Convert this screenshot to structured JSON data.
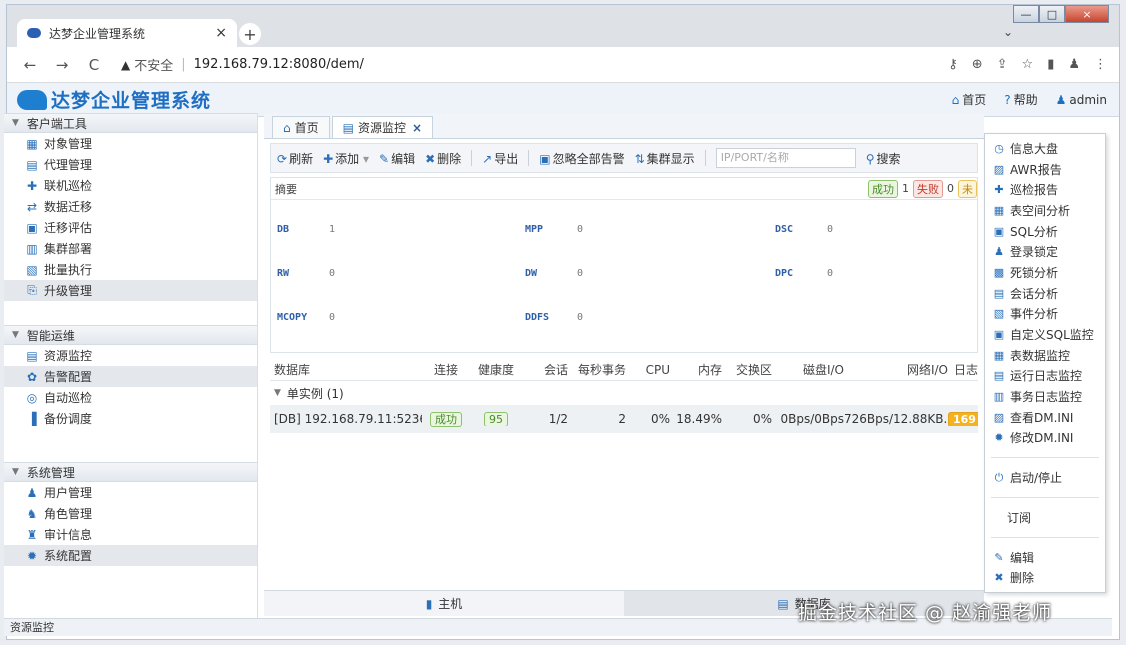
{
  "browser": {
    "tab_title": "达梦企业管理系统",
    "tab_close": "×",
    "new_tab": "+",
    "nav": {
      "back": "←",
      "forward": "→",
      "reload": "C"
    },
    "insecure_label": "不安全",
    "url": "192.168.79.12:8080/dem/",
    "window": {
      "min": "—",
      "max": "□",
      "close": "×"
    },
    "tab_dropdown": "⌄"
  },
  "app": {
    "brand": "达梦企业管理系统",
    "header_links": [
      {
        "icon": "home-icon",
        "glyph": "⌂",
        "label": "首页"
      },
      {
        "icon": "help-icon",
        "glyph": "?",
        "label": "帮助"
      },
      {
        "icon": "user-icon",
        "glyph": "♟",
        "label": "admin"
      }
    ]
  },
  "sidebar": {
    "groups": [
      {
        "title": "客户端工具",
        "items": [
          {
            "label": "对象管理",
            "icon": "object-icon",
            "glyph": "▦"
          },
          {
            "label": "代理管理",
            "icon": "proxy-icon",
            "glyph": "▤"
          },
          {
            "label": "联机巡检",
            "icon": "inspect-icon",
            "glyph": "✚"
          },
          {
            "label": "数据迁移",
            "icon": "migrate-icon",
            "glyph": "⇄"
          },
          {
            "label": "迁移评估",
            "icon": "assess-icon",
            "glyph": "▣"
          },
          {
            "label": "集群部署",
            "icon": "cluster-icon",
            "glyph": "▥"
          },
          {
            "label": "批量执行",
            "icon": "batch-icon",
            "glyph": "▧"
          },
          {
            "label": "升级管理",
            "icon": "upgrade-icon",
            "glyph": "⎘"
          }
        ]
      },
      {
        "title": "智能运维",
        "items": [
          {
            "label": "资源监控",
            "icon": "monitor-icon",
            "glyph": "▤"
          },
          {
            "label": "告警配置",
            "icon": "alarm-icon",
            "glyph": "✿"
          },
          {
            "label": "自动巡检",
            "icon": "auto-inspect-icon",
            "glyph": "◎"
          },
          {
            "label": "备份调度",
            "icon": "backup-icon",
            "glyph": "▐"
          }
        ]
      },
      {
        "title": "系统管理",
        "items": [
          {
            "label": "用户管理",
            "icon": "users-icon",
            "glyph": "♟"
          },
          {
            "label": "角色管理",
            "icon": "role-icon",
            "glyph": "♞"
          },
          {
            "label": "审计信息",
            "icon": "audit-icon",
            "glyph": "♜"
          },
          {
            "label": "系统配置",
            "icon": "settings-icon",
            "glyph": "✹"
          }
        ]
      }
    ],
    "status": "资源监控"
  },
  "content": {
    "tabs": [
      {
        "label": "首页",
        "icon": "home-icon",
        "glyph": "⌂"
      },
      {
        "label": "资源监控",
        "icon": "monitor-icon",
        "glyph": "▤",
        "close": "×"
      }
    ],
    "toolbar": {
      "refresh": "刷新",
      "add": "添加",
      "add_caret": "▾",
      "edit": "编辑",
      "delete": "删除",
      "export": "导出",
      "ignore_alerts": "忽略全部告警",
      "cluster_view": "集群显示",
      "search_placeholder": "IP/PORT/名称",
      "search": "搜索"
    },
    "summary": {
      "title": "摘要",
      "ok_label": "成功",
      "ok_count": "1",
      "fail_label": "失败",
      "fail_count": "0",
      "warn_label": "未",
      "stats": [
        {
          "key": "DB",
          "value": "1"
        },
        {
          "key": "MPP",
          "value": "0"
        },
        {
          "key": "DSC",
          "value": "0"
        },
        {
          "key": "RW",
          "value": "0"
        },
        {
          "key": "DW",
          "value": "0"
        },
        {
          "key": "DPC",
          "value": "0"
        },
        {
          "key": "MCOPY",
          "value": "0"
        },
        {
          "key": "DDFS",
          "value": "0"
        }
      ]
    },
    "table": {
      "headers": [
        "数据库",
        "连接",
        "健康度",
        "会话",
        "每秒事务",
        "CPU",
        "内存",
        "交换区",
        "磁盘I/O",
        "网络I/O",
        "日志"
      ],
      "group": "单实例 (1)",
      "row": {
        "db": "[DB] 192.168.79.11:5236",
        "conn": "成功",
        "health": "95",
        "session": "1/2",
        "tps": "2",
        "cpu": "0%",
        "mem": "18.49%",
        "swap": "0%",
        "disk": "0Bps/0Bps",
        "net": "726Bps/12.88KB...",
        "log": "169"
      }
    },
    "bottom_tabs": [
      {
        "label": "主机",
        "icon": "host-icon",
        "glyph": "▮"
      },
      {
        "label": "数据库",
        "icon": "database-icon",
        "glyph": "▤"
      }
    ]
  },
  "context_menu": {
    "group1": [
      {
        "label": "信息大盘",
        "icon": "dashboard-icon",
        "glyph": "◷"
      },
      {
        "label": "AWR报告",
        "icon": "awr-icon",
        "glyph": "▨"
      },
      {
        "label": "巡检报告",
        "icon": "inspect-report-icon",
        "glyph": "✚"
      },
      {
        "label": "表空间分析",
        "icon": "tablespace-icon",
        "glyph": "▦"
      },
      {
        "label": "SQL分析",
        "icon": "sql-icon",
        "glyph": "▣"
      },
      {
        "label": "登录锁定",
        "icon": "login-lock-icon",
        "glyph": "♟"
      },
      {
        "label": "死锁分析",
        "icon": "deadlock-icon",
        "glyph": "▩"
      },
      {
        "label": "会话分析",
        "icon": "session-icon",
        "glyph": "▤"
      },
      {
        "label": "事件分析",
        "icon": "event-icon",
        "glyph": "▧"
      },
      {
        "label": "自定义SQL监控",
        "icon": "custom-sql-icon",
        "glyph": "▣"
      },
      {
        "label": "表数据监控",
        "icon": "table-data-icon",
        "glyph": "▦"
      },
      {
        "label": "运行日志监控",
        "icon": "run-log-icon",
        "glyph": "▤"
      },
      {
        "label": "事务日志监控",
        "icon": "tx-log-icon",
        "glyph": "▥"
      },
      {
        "label": "查看DM.INI",
        "icon": "ini-icon",
        "glyph": "▨"
      },
      {
        "label": "修改DM.INI",
        "icon": "gear-icon",
        "glyph": "✹"
      }
    ],
    "start_stop": {
      "label": "启动/停止",
      "icon": "power-icon",
      "glyph": "⏻"
    },
    "subscribe": "订阅",
    "edit": {
      "label": "编辑",
      "icon": "edit-icon",
      "glyph": "✎"
    },
    "delete": {
      "label": "删除",
      "icon": "delete-icon",
      "glyph": "✖"
    }
  },
  "watermark": "掘金技术社区 @ 赵渝强老师"
}
